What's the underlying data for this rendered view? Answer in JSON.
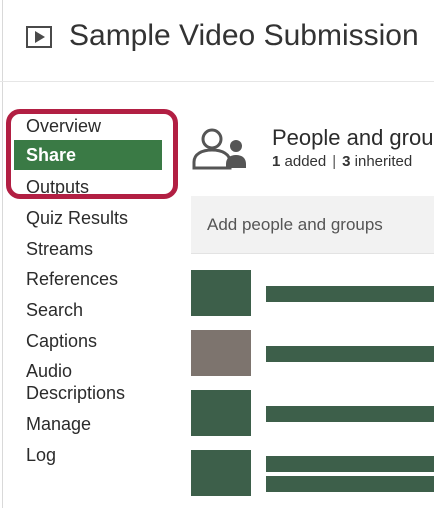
{
  "header": {
    "title": "Sample Video Submission",
    "icon": "video-play-icon"
  },
  "sidebar": {
    "items": [
      {
        "label": "Overview",
        "active": false
      },
      {
        "label": "Share",
        "active": true
      },
      {
        "label": "Outputs",
        "active": false
      },
      {
        "label": "Quiz Results",
        "active": false
      },
      {
        "label": "Streams",
        "active": false
      },
      {
        "label": "References",
        "active": false
      },
      {
        "label": "Search",
        "active": false
      },
      {
        "label": "Captions",
        "active": false
      },
      {
        "label": "Audio Descriptions",
        "active": false
      },
      {
        "label": "Manage",
        "active": false
      },
      {
        "label": "Log",
        "active": false
      }
    ],
    "highlight_color": "#b21f43",
    "active_color": "#3a7a45"
  },
  "main": {
    "section_title": "People and groups",
    "added_count": "1",
    "added_label": "added",
    "inherited_count": "3",
    "inherited_label": "inherited",
    "add_placeholder": "Add people and groups",
    "icon": "people-icon",
    "members": [
      {
        "avatar_color": "#3d5f4a"
      },
      {
        "avatar_color": "#7d746e"
      },
      {
        "avatar_color": "#3d5f4a"
      },
      {
        "avatar_color": "#3d5f4a"
      }
    ]
  }
}
